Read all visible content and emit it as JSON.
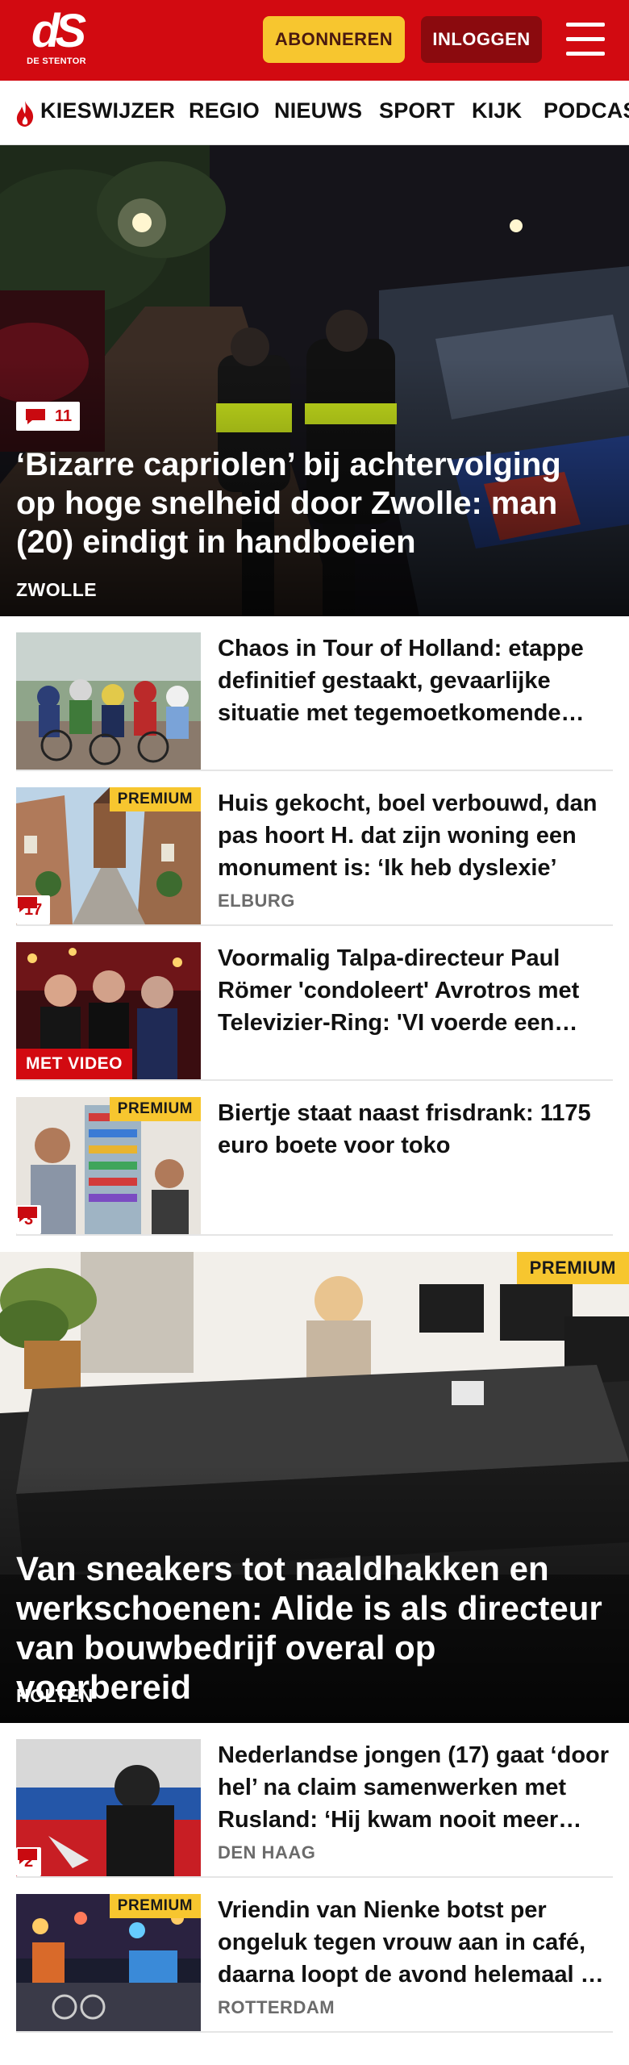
{
  "header": {
    "logo_mark": "dS",
    "logo_sub": "DE STENTOR",
    "subscribe_label": "ABONNEREN",
    "login_label": "INLOGGEN",
    "brand_color": "#d20a11",
    "menu_icon": "hamburger-icon"
  },
  "nav": {
    "items": [
      "KIESWIJZER",
      "REGIO",
      "NIEUWS",
      "SPORT",
      "KIJK",
      "PODCASTS"
    ],
    "flame_icon": "flame-icon"
  },
  "hero": {
    "comments": "11",
    "title": "‘Bizarre capriolen’ bij achtervolging op hoge snelheid door Zwolle: man (20) eindigt in handboeien",
    "tag": "ZWOLLE"
  },
  "articles": [
    {
      "title": "Chaos in Tour of Holland: etappe definitief gestaakt, gevaarlijke situatie met tegemoetkomende auto",
      "tag": "",
      "premium": "",
      "comments": "",
      "video": ""
    },
    {
      "title": "Huis gekocht, boel verbouwd, dan pas hoort H. dat zijn woning een monument is: ‘Ik heb dyslexie’",
      "tag": "ELBURG",
      "premium": "PREMIUM",
      "comments": "17",
      "video": ""
    },
    {
      "title": "Voormalig Talpa-directeur Paul Römer 'condoleert' Avrotros met Televizier-Ring: 'VI voerde een campagne'",
      "tag": "",
      "premium": "",
      "comments": "",
      "video": "MET VIDEO"
    },
    {
      "title": "Biertje staat naast frisdrank: 1175 euro boete voor toko",
      "tag": "",
      "premium": "PREMIUM",
      "comments": "3",
      "video": ""
    }
  ],
  "feature": {
    "premium": "PREMIUM",
    "title": "Van sneakers tot naaldhakken en werkschoenen: Alide is als directeur van bouwbedrijf overal op voorbereid",
    "tag": "HOLTEN"
  },
  "articles_after": [
    {
      "title": "Nederlandse jongen (17) gaat ‘door hel’ na claim samenwerken met Rusland: ‘Hij kwam nooit meer terug’",
      "tag": "DEN HAAG",
      "premium": "",
      "comments": "2"
    },
    {
      "title": "Vriendin van Nienke botst per ongeluk tegen vrouw aan in café, daarna loopt de avond helemaal uit de hand",
      "tag": "ROTTERDAM",
      "premium": "PREMIUM",
      "comments": ""
    }
  ]
}
